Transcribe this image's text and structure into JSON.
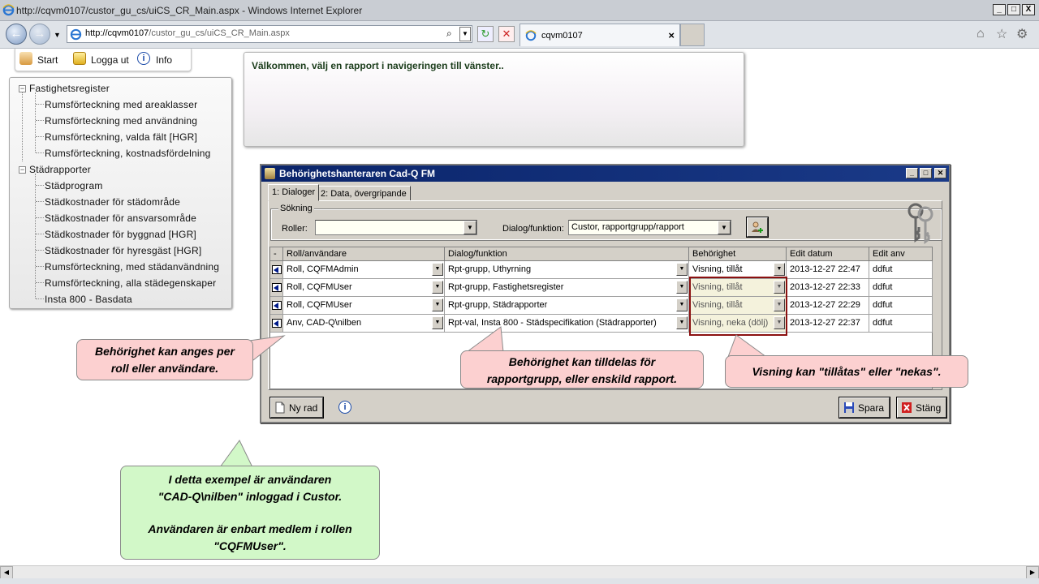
{
  "window": {
    "title": "http://cqvm0107/custor_gu_cs/uiCS_CR_Main.aspx - Windows Internet Explorer",
    "min": "_",
    "max": "□",
    "close": "X"
  },
  "browser": {
    "address_host": "http://cqvm0107",
    "address_path": "/custor_gu_cs/uiCS_CR_Main.aspx",
    "tab_title": "cqvm0107",
    "tab_close": "×"
  },
  "menu": {
    "start": "Start",
    "logout": "Logga ut",
    "info": "Info"
  },
  "tree": {
    "groups": [
      {
        "label": "Fastighetsregister",
        "toggle": "⊟",
        "items": [
          "Rumsförteckning med areaklasser",
          "Rumsförteckning med användning",
          "Rumsförteckning, valda fält [HGR]",
          "Rumsförteckning, kostnadsfördelning"
        ]
      },
      {
        "label": "Städrapporter",
        "toggle": "⊟",
        "items": [
          "Städprogram",
          "Städkostnader för städområde",
          "Städkostnader för ansvarsområde",
          "Städkostnader för byggnad [HGR]",
          "Städkostnader för hyresgäst [HGR]",
          "Rumsförteckning, med städanvändning",
          "Rumsförteckning, alla städegenskaper",
          "Insta 800 - Basdata"
        ]
      }
    ]
  },
  "welcome": "Välkommen, välj en rapport i navigeringen till vänster..",
  "dialog": {
    "title": "Behörighetshanteraren Cad-Q FM",
    "tabs": [
      "1: Dialoger",
      "2: Data, övergripande"
    ],
    "search_legend": "Sökning",
    "roles_label": "Roller:",
    "roles_value": "",
    "func_label": "Dialog/funktion:",
    "func_value": "Custor, rapportgrupp/rapport",
    "columns": [
      "-",
      "Roll/användare",
      "Dialog/funktion",
      "Behörighet",
      "Edit datum",
      "Edit anv"
    ],
    "rows": [
      {
        "role": "Roll, CQFMAdmin",
        "func": "Rpt-grupp, Uthyrning",
        "perm": "Visning, tillåt",
        "date": "2013-12-27 22:47",
        "user": "ddfut"
      },
      {
        "role": "Roll, CQFMUser",
        "func": "Rpt-grupp, Fastighetsregister",
        "perm": "Visning, tillåt",
        "date": "2013-12-27 22:33",
        "user": "ddfut"
      },
      {
        "role": "Roll, CQFMUser",
        "func": "Rpt-grupp, Städrapporter",
        "perm": "Visning, tillåt",
        "date": "2013-12-27 22:29",
        "user": "ddfut"
      },
      {
        "role": "Anv, CAD-Q\\nilben",
        "func": "Rpt-val, Insta 800 - Städspecifikation (Städrapporter)",
        "perm": "Visning, neka (dölj)",
        "date": "2013-12-27 22:37",
        "user": "ddfut"
      }
    ],
    "new_row": "Ny rad",
    "save": "Spara",
    "close": "Stäng"
  },
  "callouts": {
    "per_role_1": "Behörighet kan anges per",
    "per_role_2": "roll eller användare.",
    "assign_1": "Behörighet kan tilldelas för",
    "assign_2": "rapportgrupp, eller enskild rapport.",
    "allow": "Visning kan \"tillåtas\" eller \"nekas\".",
    "example_1": "I detta exempel är användaren",
    "example_2": "\"CAD-Q\\nilben\" inloggad i Custor.",
    "example_3": "Användaren är enbart medlem i rollen",
    "example_4": "\"CQFMUser\"."
  },
  "colors": {
    "pink_callout": "#fcd0d0",
    "green_callout": "#d2f8c8",
    "dialog_title": "#0a246a",
    "highlight": "#8b1010"
  }
}
